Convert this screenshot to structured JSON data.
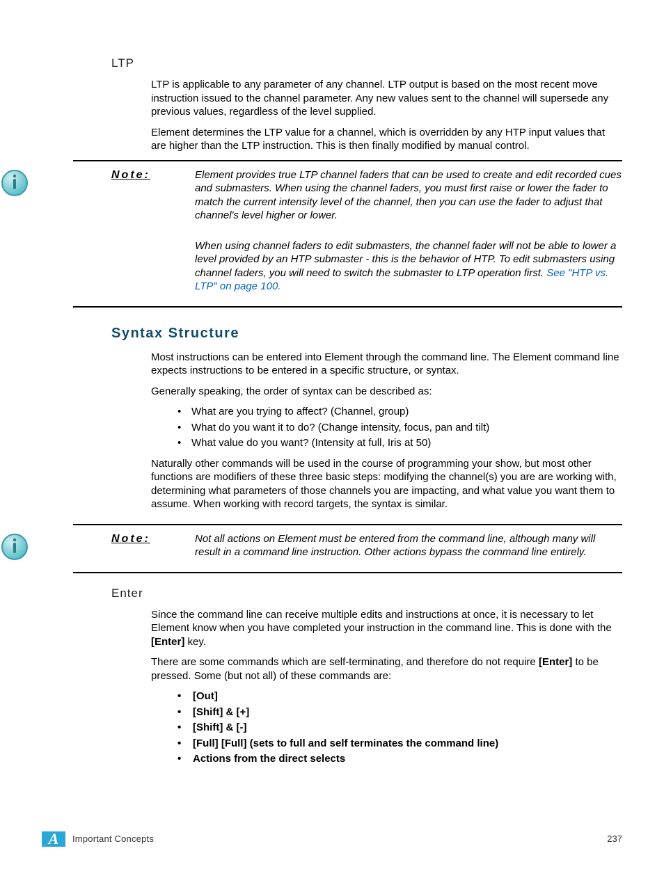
{
  "ltp": {
    "heading": "LTP",
    "p1": "LTP is applicable to any parameter of any channel. LTP output is based on the most recent move instruction issued to the channel parameter. Any new values sent to the channel will supersede any previous values, regardless of the level supplied.",
    "p2": "Element determines the LTP value for a channel, which is overridden by any HTP input values that are higher than the LTP instruction. This is then finally modified by manual control."
  },
  "note1": {
    "label": "Note:",
    "p1": "Element provides true LTP channel faders that can be used to create and edit recorded cues and submasters. When using the channel faders, you must first raise or lower the fader to match the current intensity level of the channel, then you can use the fader to adjust that channel's level higher or lower.",
    "p2a": "When using channel faders to edit submasters, the channel fader will not be able to lower a level provided by an HTP submaster - this is the behavior of HTP. To edit submasters using channel faders, you will need to switch the submaster to LTP operation first. ",
    "p2_link": "See \"HTP vs. LTP\" on page 100."
  },
  "syntax": {
    "heading": "Syntax Structure",
    "p1": "Most instructions can be entered into Element through the command line. The Element command line expects instructions to be entered in a specific structure, or syntax.",
    "p2": "Generally speaking, the order of syntax can be described as:",
    "bullets": [
      "What are you trying to affect? (Channel, group)",
      "What do you want it to do? (Change intensity, focus, pan and tilt)",
      "What value do you want? (Intensity at full, Iris at 50)"
    ],
    "p3": "Naturally other commands will be used in the course of programming your show, but most other functions are modifiers of these three basic steps: modifying the channel(s) you are are working with, determining what parameters of those channels you are impacting, and what value you want them to assume. When working with record targets, the syntax is similar."
  },
  "note2": {
    "label": "Note:",
    "p1": "Not all actions on Element must be entered from the command line, although many will result in a command line instruction. Other actions bypass the command line entirely."
  },
  "enter": {
    "heading": "Enter",
    "p1a": "Since the command line can receive multiple edits and instructions at once, it is necessary to let Element know when you have completed your instruction in the command line. This is done with the ",
    "p1b": "[Enter]",
    "p1c": " key.",
    "p2a": "There are some commands which are self-terminating, and therefore do not require ",
    "p2b": "[Enter]",
    "p2c": " to be pressed. Some (but not all) of these commands are:",
    "bullets": [
      "[Out]",
      "[Shift] & [+]",
      "[Shift] & [-]",
      "[Full] [Full] (sets to full and self terminates the command line)",
      "Actions from the direct selects"
    ]
  },
  "footer": {
    "appendix": "A",
    "title": "Important Concepts",
    "page": "237"
  }
}
